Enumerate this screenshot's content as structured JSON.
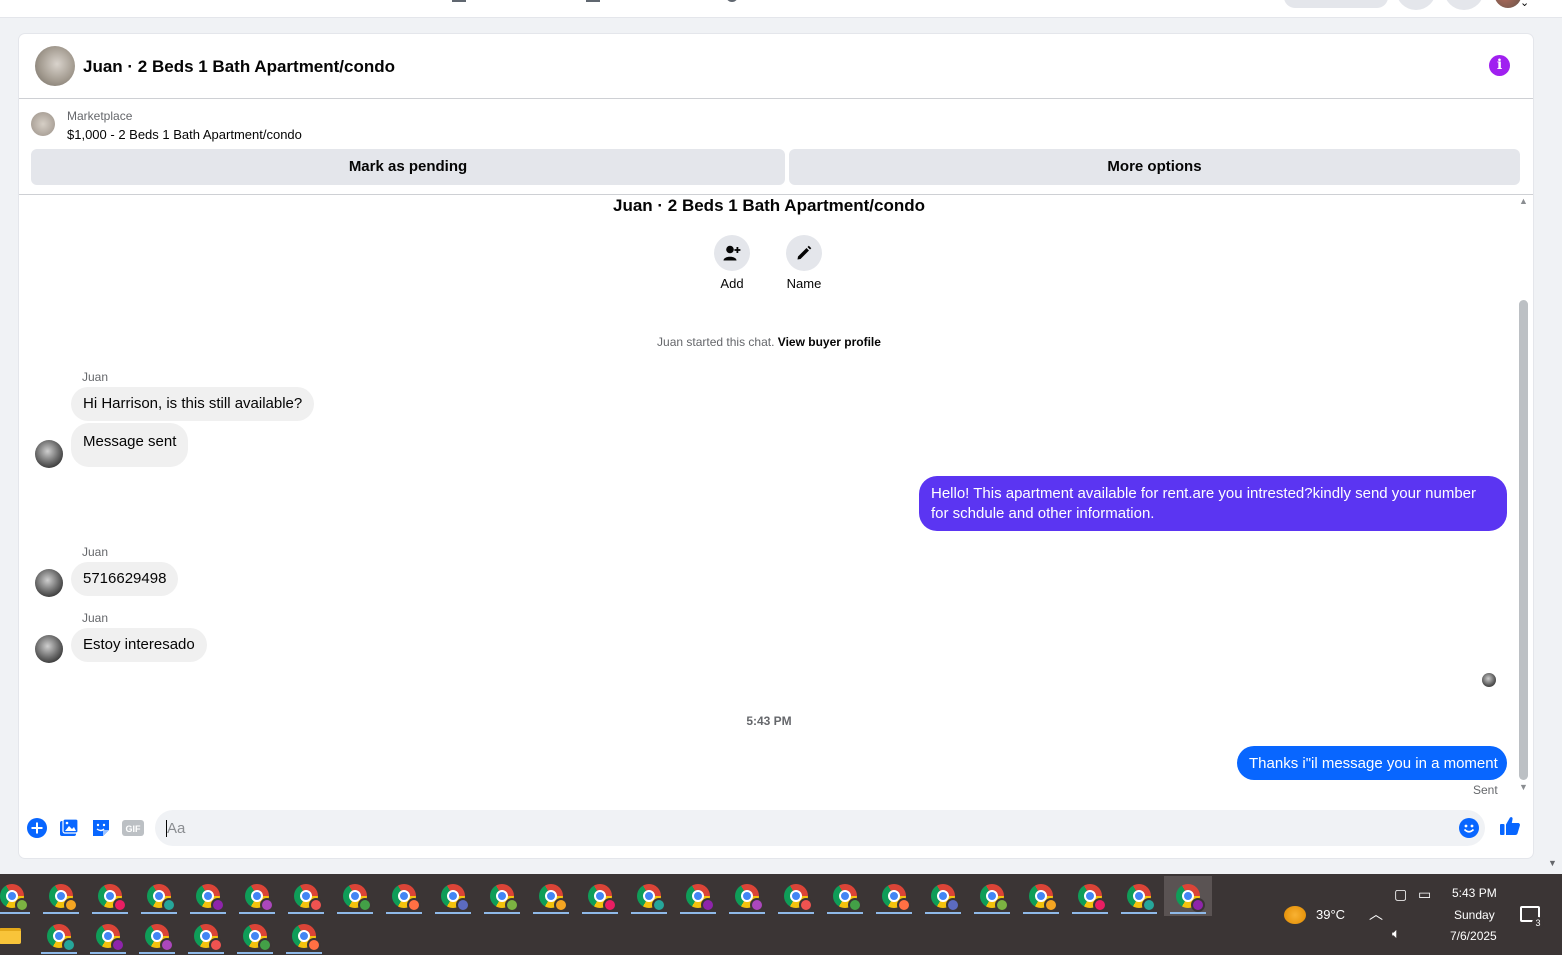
{
  "conversation": {
    "title": "Juan · 2 Beds 1 Bath Apartment/condo",
    "started_by": "Juan started this chat.",
    "view_profile_link": "View buyer profile",
    "actions": [
      {
        "label": "Add",
        "icon": "add-person-icon"
      },
      {
        "label": "Name",
        "icon": "pencil-icon"
      }
    ]
  },
  "marketplace": {
    "label": "Marketplace",
    "listing": "$1,000 - 2 Beds 1 Bath Apartment/condo",
    "mark_pending_label": "Mark as pending",
    "more_options_label": "More options"
  },
  "messages": [
    {
      "sender": "Juan",
      "text": "Hi Harrison, is this still available?",
      "direction": "in"
    },
    {
      "text": "Message sent",
      "direction": "in"
    },
    {
      "text": "Hello! This apartment available for rent.are you intrested?kindly send your number for schdule and other information.",
      "direction": "out"
    },
    {
      "sender": "Juan",
      "text": "5716629498",
      "direction": "in"
    },
    {
      "sender": "Juan",
      "text": "Estoy interesado",
      "direction": "in"
    },
    {
      "timestamp": "5:43 PM"
    },
    {
      "text": "Thanks i\"il message you in a moment",
      "direction": "out",
      "status": "Sent"
    }
  ],
  "composer": {
    "placeholder": "Aa",
    "icons": [
      "plus-icon",
      "photo-icon",
      "sticker-icon",
      "gif-icon",
      "emoji-icon",
      "like-icon"
    ],
    "gif_label": "GIF"
  },
  "colors": {
    "outgoing_purple": "#5b35f2",
    "outgoing_blue": "#0866ff",
    "info_accent": "#a020f0"
  },
  "taskbar": {
    "weather": "39°C",
    "time": "5:43 PM",
    "day": "Sunday",
    "date": "7/6/2025",
    "notification_count": "3"
  }
}
